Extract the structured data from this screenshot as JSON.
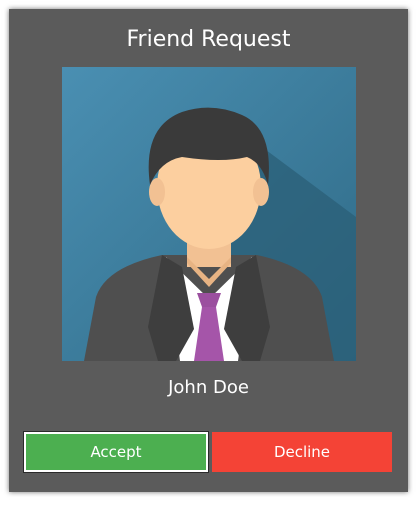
{
  "dialog": {
    "title": "Friend Request",
    "avatar_icon": "user-avatar-icon",
    "name": "John Doe"
  },
  "actions": {
    "accept_label": "Accept",
    "decline_label": "Decline"
  },
  "colors": {
    "card_background": "#5b5b5b",
    "accept": "#4caf50",
    "decline": "#f44336",
    "avatar_background": "#3f7f9f"
  }
}
